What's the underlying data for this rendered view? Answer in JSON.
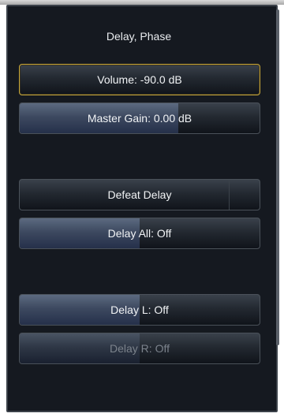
{
  "panel": {
    "title": "Delay, Phase"
  },
  "buttons": {
    "volume": {
      "label": "Volume: -90.0 dB",
      "level_fraction": 0.0
    },
    "master_gain": {
      "label": "Master Gain: 0.00 dB",
      "level_fraction": 0.66
    },
    "defeat_delay": {
      "label": "Defeat Delay"
    },
    "delay_all": {
      "label": "Delay All: Off",
      "level_fraction": 0.5
    },
    "delay_l": {
      "label": "Delay L: Off",
      "level_fraction": 0.5
    },
    "delay_r": {
      "label": "Delay R: Off",
      "level_fraction": 0.5
    }
  },
  "colors": {
    "selection_border": "#c7a73a",
    "panel_bg": "#151920",
    "fill": "#3d4960"
  }
}
